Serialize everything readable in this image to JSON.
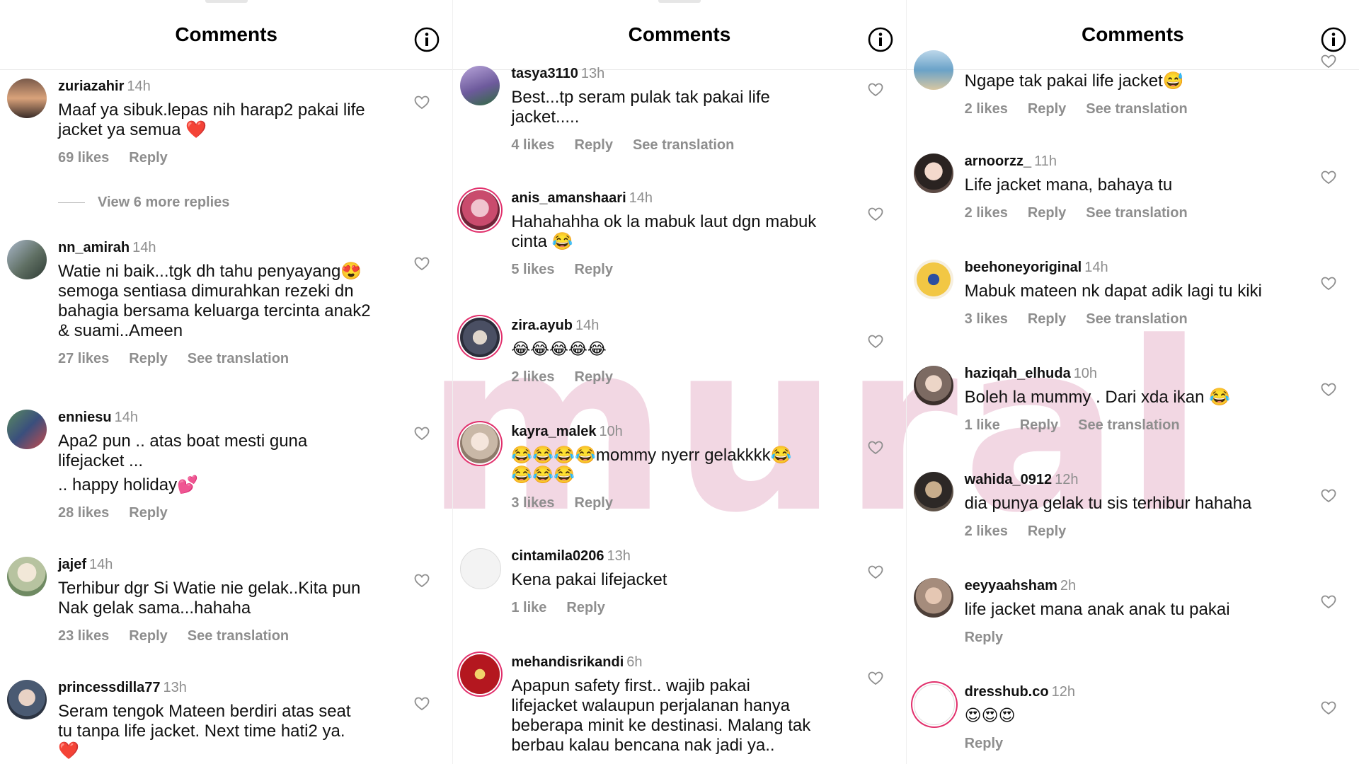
{
  "panels": [
    {
      "title": "Comments",
      "comments": [
        {
          "user": "zuriazahir",
          "time": "14h",
          "lines": [
            "Maaf ya sibuk.lepas nih harap2 pakai life",
            "jacket ya semua ❤️"
          ],
          "likes": "69 likes",
          "reply": "Reply",
          "translate": "",
          "more_replies": "View 6 more replies"
        },
        {
          "user": "nn_amirah",
          "time": "14h",
          "lines": [
            "Watie ni baik...tgk dh tahu penyayang😍",
            "semoga sentiasa dimurahkan rezeki dn",
            "bahagia bersama keluarga tercinta anak2",
            "& suami..Ameen"
          ],
          "likes": "27 likes",
          "reply": "Reply",
          "translate": "See translation"
        },
        {
          "user": "enniesu",
          "time": "14h",
          "lines": [
            "Apa2 pun .. atas boat mesti guna",
            "lifejacket ...",
            ".. happy holiday💕"
          ],
          "likes": "28 likes",
          "reply": "Reply",
          "translate": ""
        },
        {
          "user": "jajef",
          "time": "14h",
          "lines": [
            "Terhibur dgr Si Watie nie gelak..Kita pun",
            "Nak gelak sama...hahaha"
          ],
          "likes": "23 likes",
          "reply": "Reply",
          "translate": "See translation"
        },
        {
          "user": "princessdilla77",
          "time": "13h",
          "lines": [
            "Seram tengok Mateen berdiri atas seat",
            "tu tanpa life jacket. Next time hati2 ya.",
            "❤️"
          ],
          "likes": "",
          "reply": "",
          "translate": ""
        }
      ]
    },
    {
      "title": "Comments",
      "comments": [
        {
          "user": "tasya3110",
          "time": "13h",
          "lines": [
            "Best...tp seram pulak tak pakai life",
            "jacket....."
          ],
          "likes": "4 likes",
          "reply": "Reply",
          "translate": "See translation"
        },
        {
          "user": "anis_amanshaari",
          "time": "14h",
          "lines": [
            "Hahahahha ok la mabuk laut dgn mabuk",
            "cinta 😂"
          ],
          "likes": "5 likes",
          "reply": "Reply",
          "translate": ""
        },
        {
          "user": "zira.ayub",
          "time": "14h",
          "lines": [
            "😂😂😂😂😂"
          ],
          "likes": "2 likes",
          "reply": "Reply",
          "translate": ""
        },
        {
          "user": "kayra_malek",
          "time": "10h",
          "lines": [
            "😂😂😂😂mommy nyerr gelakkkk😂",
            "😂😂😂"
          ],
          "likes": "3 likes",
          "reply": "Reply",
          "translate": ""
        },
        {
          "user": "cintamila0206",
          "time": "13h",
          "lines": [
            "Kena pakai lifejacket"
          ],
          "likes": "1 like",
          "reply": "Reply",
          "translate": ""
        },
        {
          "user": "mehandisrikandi",
          "time": "6h",
          "lines": [
            "Apapun safety first.. wajib pakai",
            "lifejacket walaupun perjalanan hanya",
            "beberapa minit ke destinasi. Malang tak",
            "berbau kalau bencana nak jadi ya.."
          ],
          "likes": "",
          "reply": "",
          "translate": ""
        }
      ]
    },
    {
      "title": "Comments",
      "comments": [
        {
          "user": "",
          "time": "",
          "lines": [
            "Ngape tak pakai life jacket😅"
          ],
          "likes": "2 likes",
          "reply": "Reply",
          "translate": "See translation"
        },
        {
          "user": "arnoorzz_",
          "time": "11h",
          "lines": [
            "Life jacket mana, bahaya tu"
          ],
          "likes": "2 likes",
          "reply": "Reply",
          "translate": "See translation"
        },
        {
          "user": "beehoneyoriginal",
          "time": "14h",
          "lines": [
            "Mabuk mateen nk dapat adik lagi tu kiki"
          ],
          "likes": "3 likes",
          "reply": "Reply",
          "translate": "See translation"
        },
        {
          "user": "haziqah_elhuda",
          "time": "10h",
          "lines": [
            "Boleh la mummy . Dari xda ikan 😂"
          ],
          "likes": "1 like",
          "reply": "Reply",
          "translate": "See translation"
        },
        {
          "user": "wahida_0912",
          "time": "12h",
          "lines": [
            "dia punya gelak tu sis terhibur hahaha"
          ],
          "likes": "2 likes",
          "reply": "Reply",
          "translate": ""
        },
        {
          "user": "eeyyaahsham",
          "time": "2h",
          "lines": [
            "life jacket mana anak anak tu pakai"
          ],
          "likes": "",
          "reply": "Reply",
          "translate": ""
        },
        {
          "user": "dresshub.co",
          "time": "12h",
          "lines": [
            "😍😍😍"
          ],
          "likes": "",
          "reply": "Reply",
          "translate": ""
        }
      ]
    }
  ],
  "watermark": "mural",
  "colors": {
    "text": "#111111",
    "muted": "#8e8e8e",
    "story_ring": "#e1306c",
    "heart_red": "#e0245e"
  }
}
